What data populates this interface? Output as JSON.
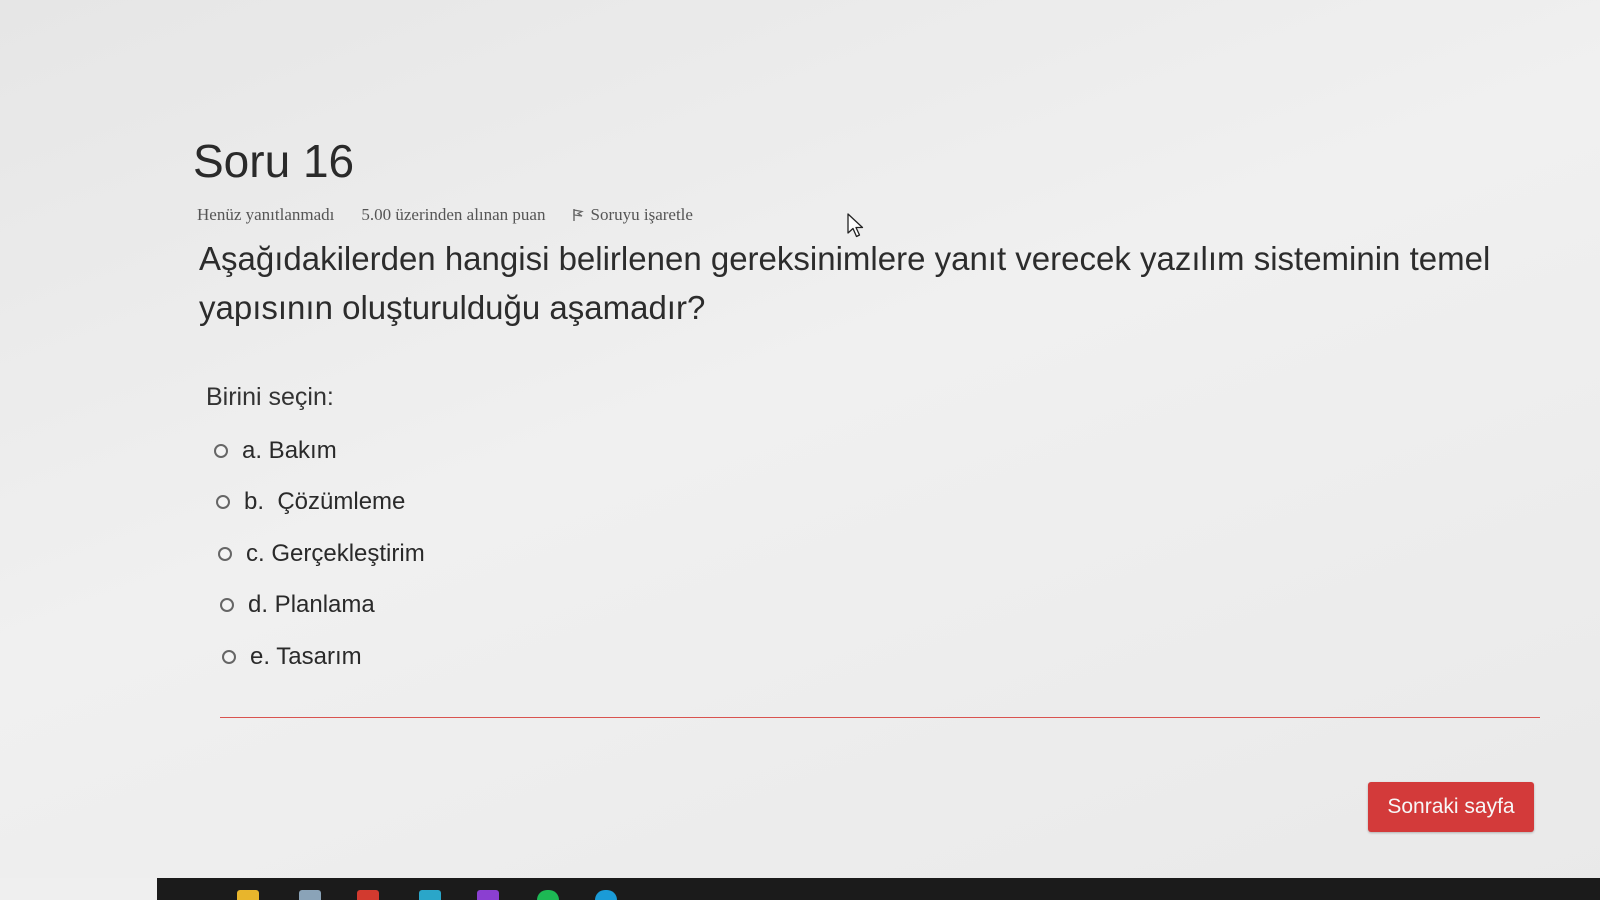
{
  "question": {
    "title": "Soru 16",
    "status": "Henüz yanıtlanmadı",
    "grade": "5.00 üzerinden alınan puan",
    "flag_label": "Soruyu işaretle",
    "text": "Aşağıdakilerden hangisi belirlenen gereksinimlere yanıt verecek yazılım sisteminin temel yapısının oluşturulduğu aşamadır?",
    "prompt": "Birini seçin:",
    "answers": [
      {
        "label": "a. Bakım"
      },
      {
        "label": "b.  Çözümleme"
      },
      {
        "label": "c. Gerçekleştirim"
      },
      {
        "label": "d. Planlama"
      },
      {
        "label": "e. Tasarım"
      }
    ]
  },
  "navigation": {
    "next_label": "Sonraki sayfa"
  },
  "colors": {
    "accent": "#d33a3a",
    "divider": "#d9534f",
    "background": "#ececec",
    "taskbar": "#1b1b1b"
  },
  "icons": {
    "flag": "flag-icon",
    "cursor": "mouse-pointer-icon",
    "radio": "radio-empty"
  }
}
